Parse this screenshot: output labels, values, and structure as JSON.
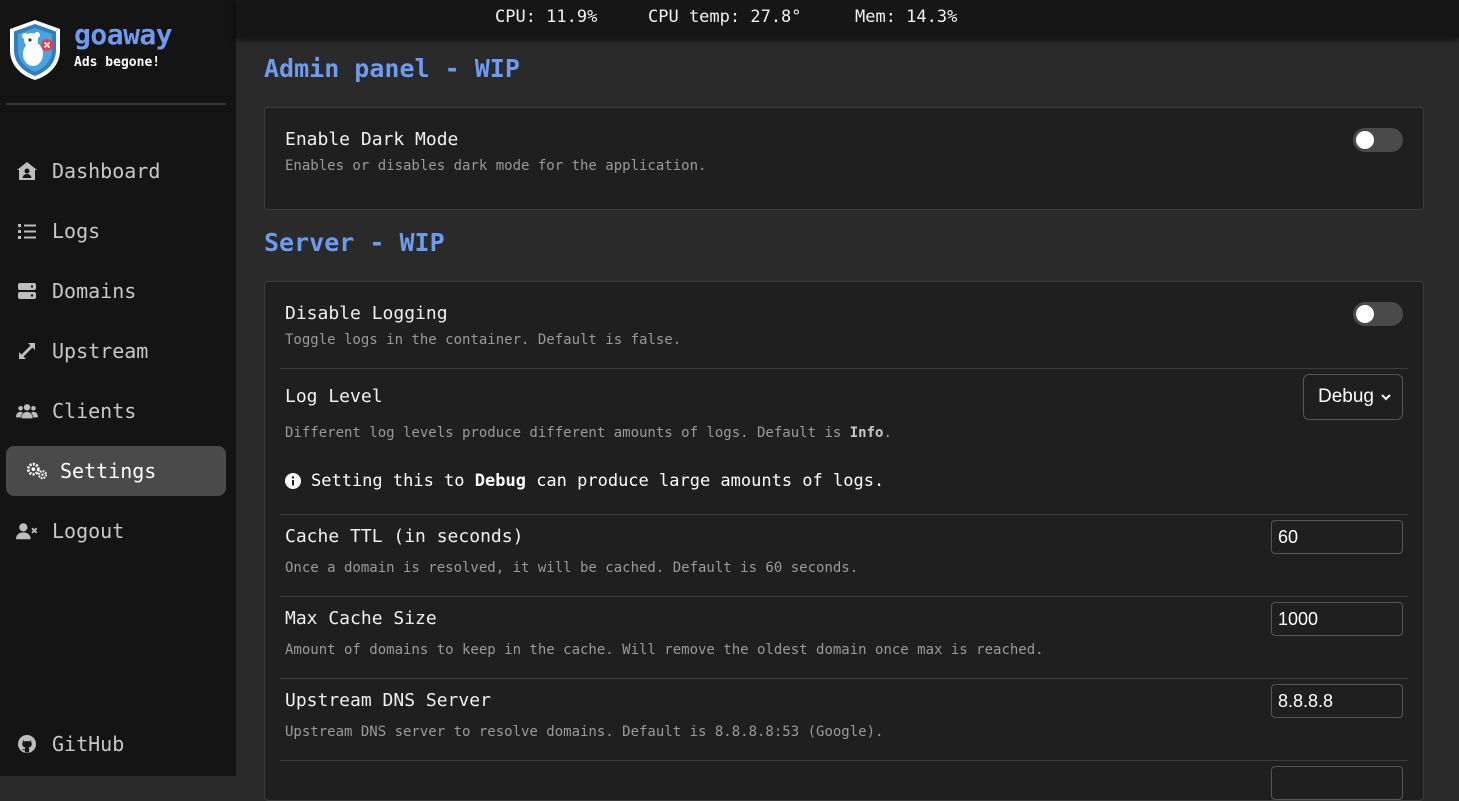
{
  "app": {
    "name": "goaway",
    "tagline": "Ads begone!"
  },
  "stats": {
    "cpu": "CPU: 11.9%",
    "cpu_temp": "CPU temp: 27.8°",
    "mem": "Mem: 14.3%"
  },
  "nav": {
    "dashboard": "Dashboard",
    "logs": "Logs",
    "domains": "Domains",
    "upstream": "Upstream",
    "clients": "Clients",
    "settings": "Settings",
    "logout": "Logout",
    "github": "GitHub"
  },
  "admin": {
    "title": "Admin panel - WIP",
    "dark_mode_title": "Enable Dark Mode",
    "dark_mode_desc": "Enables or disables dark mode for the application."
  },
  "server": {
    "title": "Server - WIP",
    "disable_logging_title": "Disable Logging",
    "disable_logging_desc": "Toggle logs in the container. Default is false.",
    "log_level_title": "Log Level",
    "log_level_value": "Debug",
    "log_level_desc_prefix": "Different log levels produce different amounts of logs. Default is ",
    "log_level_desc_default": "Info",
    "log_level_desc_suffix": ".",
    "note_prefix": "Setting this to ",
    "note_bold": "Debug",
    "note_suffix": " can produce large amounts of logs.",
    "cache_ttl_title": "Cache TTL (in seconds)",
    "cache_ttl_value": "60",
    "cache_ttl_desc": "Once a domain is resolved, it will be cached. Default is 60 seconds.",
    "max_cache_title": "Max Cache Size",
    "max_cache_value": "1000",
    "max_cache_desc": "Amount of domains to keep in the cache. Will remove the oldest domain once max is reached.",
    "upstream_title": "Upstream DNS Server",
    "upstream_value": "8.8.8.8",
    "upstream_desc": "Upstream DNS server to resolve domains. Default is 8.8.8.8:53 (Google)."
  },
  "toggles": {
    "dark_mode_on": false,
    "disable_logging_on": false
  },
  "colors": {
    "accent": "#6d9bef",
    "sidebar_bg": "#141414",
    "main_bg": "#2a2a2a",
    "card_bg": "#1f1f1f",
    "active_nav": "#4a4a4a"
  },
  "icons": {
    "logo": "goaway-shield-logo",
    "dashboard": "house-user-icon",
    "logs": "list-icon",
    "domains": "server-icon",
    "upstream": "expand-arrows-icon",
    "clients": "users-icon",
    "settings": "gears-icon",
    "logout": "user-x-icon",
    "github": "github-icon",
    "info": "info-circle-icon"
  }
}
